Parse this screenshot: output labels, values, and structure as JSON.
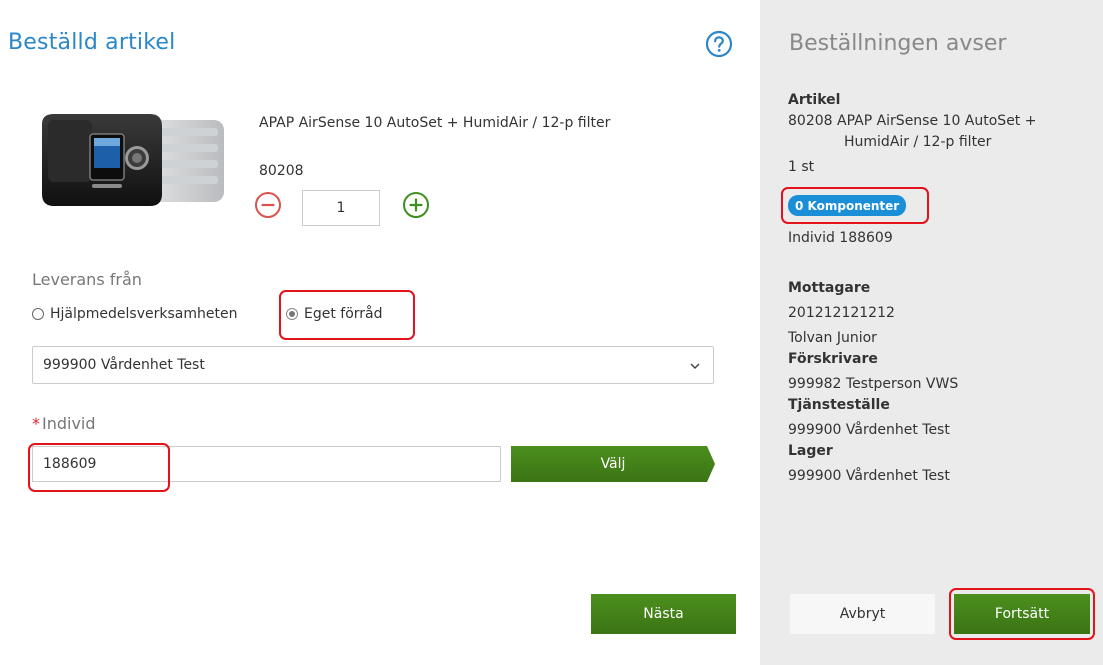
{
  "order": {
    "title": "Beställd artikel",
    "product": {
      "name": "APAP AirSense 10 AutoSet + HumidAir / 12-p filter",
      "code": "80208",
      "quantity": "1"
    },
    "delivery": {
      "label": "Leverans från",
      "options": [
        "Hjälpmedelsverksamheten",
        "Eget förråd"
      ],
      "selected": "Eget förråd",
      "unit_select": "999900 Vårdenhet Test"
    },
    "individ": {
      "required_mark": "*",
      "label": "Individ",
      "value": "188609",
      "select_button": "Välj"
    },
    "next_button": "Nästa"
  },
  "summary": {
    "title": "Beställningen avser",
    "artikel": {
      "heading": "Artikel",
      "line1": "80208 APAP AirSense 10 AutoSet +",
      "line2": "HumidAir / 12-p filter",
      "count": "1 st",
      "badge": "0 Komponenter",
      "individ": "Individ 188609"
    },
    "mottagare": {
      "heading": "Mottagare",
      "id": "201212121212",
      "name": "Tolvan Junior"
    },
    "forskrivare": {
      "heading": "Förskrivare",
      "value": "999982 Testperson VWS"
    },
    "tjanstestalle": {
      "heading": "Tjänsteställe",
      "value": "999900 Vårdenhet Test"
    },
    "lager": {
      "heading": "Lager",
      "value": "999900 Vårdenhet Test"
    },
    "cancel_button": "Avbryt",
    "continue_button": "Fortsätt"
  },
  "colors": {
    "title_blue": "#2a87c9",
    "green": "#3f7d18",
    "badge_blue": "#1a8fd8",
    "annotation_red": "#e3121b",
    "panel_gray": "#ebebeb"
  },
  "icons": {
    "help": "help-circle-icon",
    "minus": "minus-circle-icon",
    "plus": "plus-circle-icon",
    "dropdown": "chevron-down-icon"
  }
}
